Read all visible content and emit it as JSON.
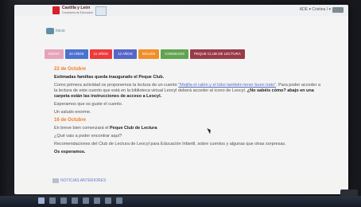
{
  "header": {
    "logo_text": "Castilla y León",
    "logo_sub": "Consejería de Educación",
    "user_text": "ADE ▾  Cristina I ▾"
  },
  "navigation": {
    "back_label": "Inicio"
  },
  "tabs": [
    {
      "label": "INICIO",
      "color": "#e6a3ba"
    },
    {
      "label": "10 AÑOS",
      "color": "#4a72cf"
    },
    {
      "label": "11 AÑOS",
      "color": "#ee3a3a"
    },
    {
      "label": "12 AÑOS",
      "color": "#5566c8"
    },
    {
      "label": "INGLÉS",
      "color": "#f08f2a"
    },
    {
      "label": "CONSEJOS",
      "color": "#62a34f"
    },
    {
      "label": "PEQUE CLUB DE LECTURA",
      "color": "#993b47"
    }
  ],
  "article": {
    "date1": "22 de Octubre",
    "headline": "Estimadas familias queda inaugurado el Peque Club.",
    "paragraph1_a": "Como primera actividad os proponemos la lectura de un cuento",
    "paragraph1_link": "\"Mejilla el ratón y el lobo también tener buen trato\"",
    "paragraph1_b": ". Para poder acceder a la lectura de este cuento que está en la biblioteca virtual Leocyl deberá acceder al icono de Leocyl.",
    "paragraph1_bold": "¿No sabéis cómo? abajo en una carpeta están las instrucciones de acceso a Leocyl.",
    "paragraph2": "Esperamos que os guste el cuento.",
    "sign": "Un saludo enorme.",
    "date2": "16 de Octubre",
    "paragraph3_a": "En breve bien comenzará el",
    "paragraph3_bold": "Peque Club de Lectura",
    "paragraph4": "¿Qué vais a poder encontrar aquí?",
    "paragraph5": "Recomendaciones del Club de Lectura de Leocyl para Educación Infantil, sobre cuentos y algunas que otras sorpresas.",
    "closing": "Os esperamos."
  },
  "footer": {
    "link_text": "NOTICIAS ANTERIORES"
  }
}
